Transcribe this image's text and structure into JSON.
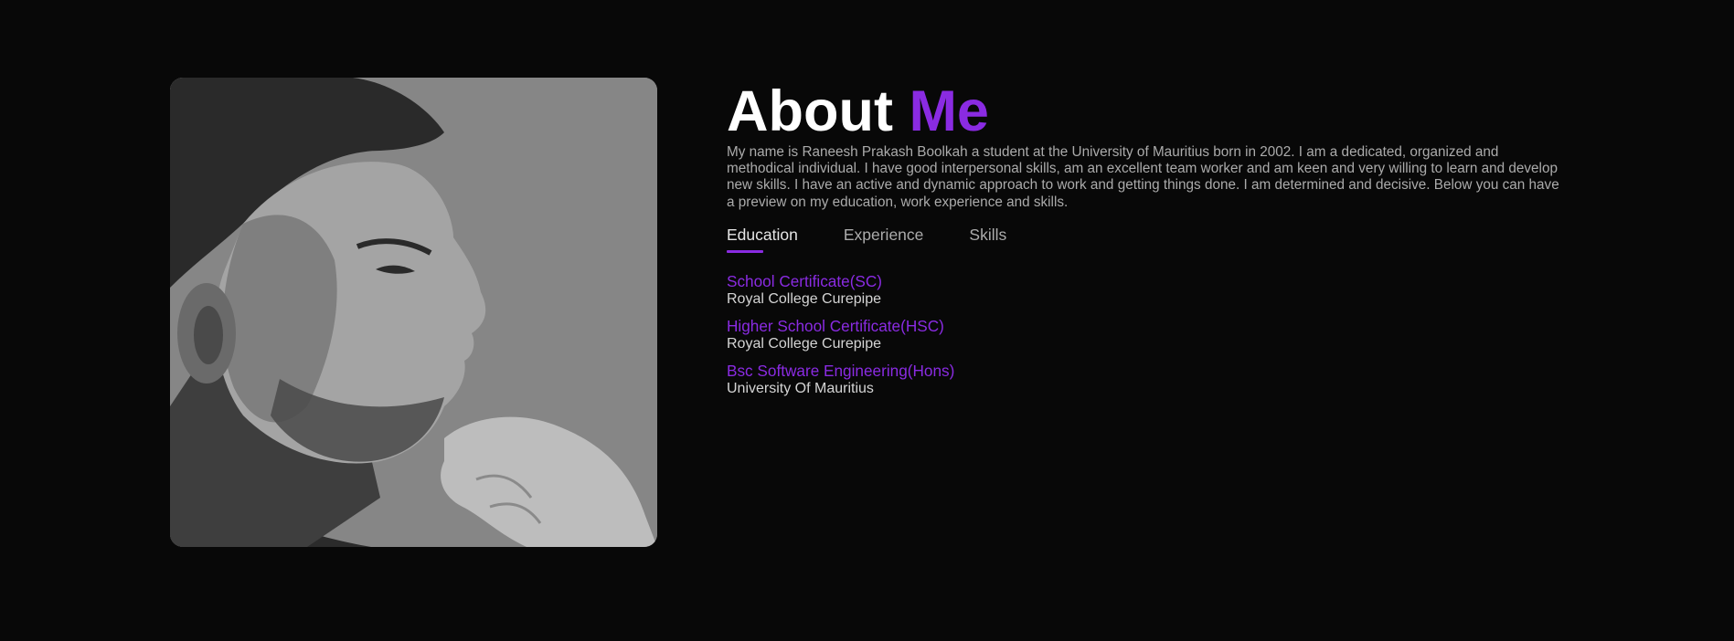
{
  "about": {
    "heading_main": "About",
    "heading_accent": "Me",
    "bio": "My name is Raneesh Prakash Boolkah a student at the University of Mauritius born in 2002. I am a dedicated, organized and methodical individual. I have good interpersonal skills, am an excellent team worker and am keen and very willing to learn and develop new skills. I have an active and dynamic approach to work and getting things done. I am determined and decisive. Below you can have a preview on my education, work experience and skills."
  },
  "tabs": [
    {
      "label": "Education",
      "active": true
    },
    {
      "label": "Experience",
      "active": false
    },
    {
      "label": "Skills",
      "active": false
    }
  ],
  "education": [
    {
      "title": "School Certificate(SC)",
      "school": "Royal College Curepipe"
    },
    {
      "title": "Higher School Certificate(HSC)",
      "school": "Royal College Curepipe"
    },
    {
      "title": "Bsc Software Engineering(Hons)",
      "school": "University Of Mauritius"
    }
  ],
  "colors": {
    "background": "#080808",
    "accent": "#8a2be2",
    "text_muted": "#ababab",
    "text_light": "#d4d4d4"
  }
}
